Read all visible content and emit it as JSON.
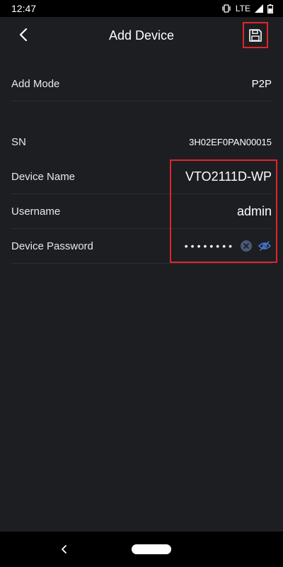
{
  "status_bar": {
    "time": "12:47",
    "network": "LTE"
  },
  "header": {
    "title": "Add Device",
    "back_icon": "chevron-left-icon",
    "save_icon": "floppy-disk-icon"
  },
  "form": {
    "add_mode": {
      "label": "Add Mode",
      "value": "P2P"
    },
    "sn": {
      "label": "SN",
      "value": "3H02EF0PAN00015"
    },
    "device_name": {
      "label": "Device Name",
      "value": "VTO2111D-WP"
    },
    "username": {
      "label": "Username",
      "value": "admin"
    },
    "device_password": {
      "label": "Device Password",
      "masked_value": "••••••••"
    }
  },
  "colors": {
    "background": "#1d1e22",
    "highlight": "#e0252a",
    "accent": "#4b7bdc"
  }
}
